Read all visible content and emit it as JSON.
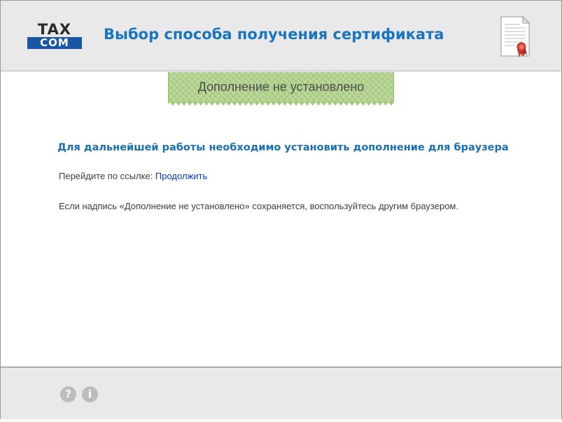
{
  "header": {
    "logo": {
      "top": "TAX",
      "bottom": "COM"
    },
    "title": "Выбор способа получения сертификата",
    "certificate_icon": "certificate-document-icon"
  },
  "status": {
    "label": "Дополнение не установлено",
    "color": "#a5ca7b"
  },
  "main": {
    "heading": "Для дальнейшей работы необходимо установить дополнение для браузера",
    "instruction_prefix": "Перейдите по ссылке:",
    "continue_link": "Продолжить",
    "note": "Если надпись «Дополнение не установлено» сохраняется, воспользуйтесь другим браузером."
  },
  "footer": {
    "help_icon": "?",
    "info_icon": "i"
  },
  "colors": {
    "accent": "#1a75c0",
    "link": "#0b35c4",
    "panel": "#e9e9e9"
  }
}
